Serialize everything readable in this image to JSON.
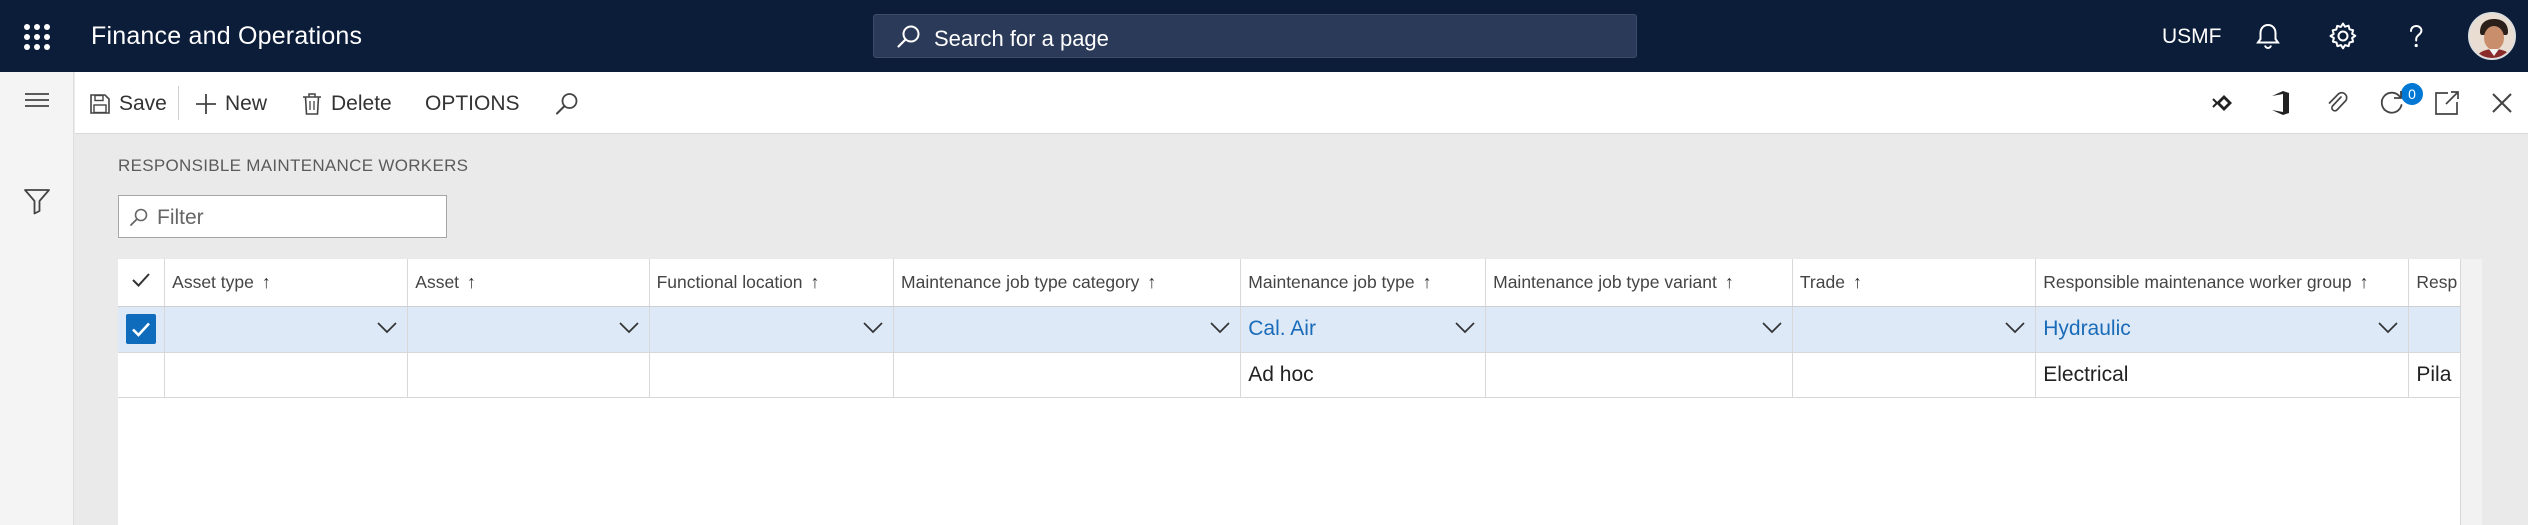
{
  "topbar": {
    "app_title": "Finance and Operations",
    "search_placeholder": "Search for a page",
    "company": "USMF"
  },
  "actions": {
    "save": "Save",
    "new": "New",
    "delete": "Delete",
    "options": "OPTIONS",
    "attachments_count": "0"
  },
  "page": {
    "section_title": "RESPONSIBLE MAINTENANCE WORKERS",
    "filter_placeholder": "Filter"
  },
  "grid": {
    "columns": [
      {
        "label": "Asset type",
        "sort": "↑"
      },
      {
        "label": "Asset",
        "sort": "↑"
      },
      {
        "label": "Functional location",
        "sort": "↑"
      },
      {
        "label": "Maintenance job type category",
        "sort": "↑"
      },
      {
        "label": "Maintenance job type",
        "sort": "↑"
      },
      {
        "label": "Maintenance job type variant",
        "sort": "↑"
      },
      {
        "label": "Trade",
        "sort": "↑"
      },
      {
        "label": "Responsible maintenance worker group",
        "sort": "↑"
      },
      {
        "label": "Resp",
        "sort": ""
      }
    ],
    "rows": [
      {
        "selected": true,
        "cells": [
          "",
          "",
          "",
          "",
          "Cal. Air",
          "",
          "",
          "Hydraulic",
          ""
        ]
      },
      {
        "selected": false,
        "cells": [
          "",
          "",
          "",
          "",
          "Ad hoc",
          "",
          "",
          "Electrical",
          "Pila"
        ]
      }
    ]
  },
  "colors": {
    "topbar": "#0b1d39",
    "accent": "#0f6cbd",
    "selected_row": "#dde9f7",
    "link": "#1a6bb8"
  }
}
